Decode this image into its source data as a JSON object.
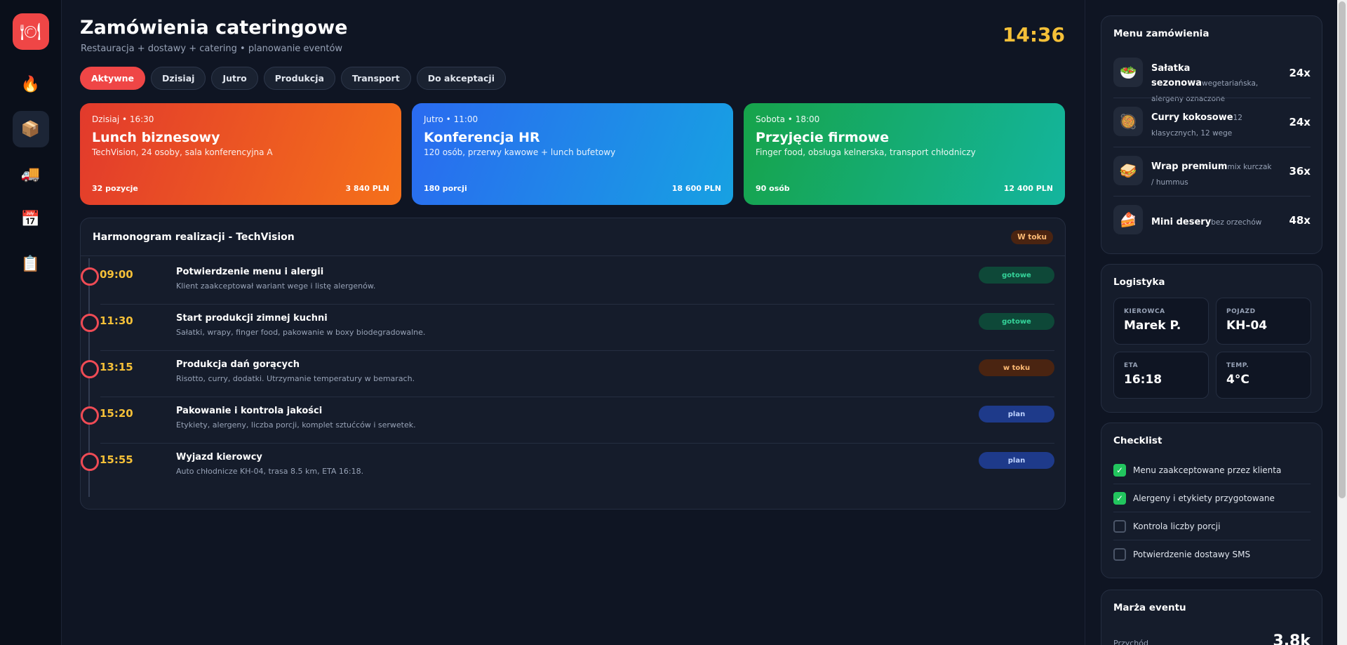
{
  "app": {
    "title": "Zamówienia cateringowe",
    "subtitle": "Restauracja + dostawy + catering • planowanie eventów",
    "clock": "14:36"
  },
  "sidebar": {
    "logo_icon": "plate-cutlery-icon",
    "items": [
      {
        "icon": "fire-icon",
        "glyph": "🔥"
      },
      {
        "icon": "package-icon",
        "glyph": "📦"
      },
      {
        "icon": "delivery-truck-icon",
        "glyph": "🚚"
      },
      {
        "icon": "calendar-icon",
        "glyph": "📅"
      },
      {
        "icon": "clipboard-icon",
        "glyph": "📋"
      }
    ]
  },
  "tabs": [
    "Aktywne",
    "Dzisiaj",
    "Jutro",
    "Produkcja",
    "Transport",
    "Do akceptacji"
  ],
  "events": [
    {
      "when": "Dzisiaj • 16:30",
      "title": "Lunch biznesowy",
      "desc": "TechVision, 24 osoby, sala konferencyjna A",
      "count": "32 pozycje",
      "price": "3 840 PLN"
    },
    {
      "when": "Jutro • 11:00",
      "title": "Konferencja HR",
      "desc": "120 osób, przerwy kawowe + lunch bufetowy",
      "count": "180 porcji",
      "price": "18 600 PLN"
    },
    {
      "when": "Sobota • 18:00",
      "title": "Przyjęcie firmowe",
      "desc": "Finger food, obsługa kelnerska, transport chłodniczy",
      "count": "90 osób",
      "price": "12 400 PLN"
    }
  ],
  "schedule": {
    "title": "Harmonogram realizacji - TechVision",
    "badge": "W toku",
    "rows": [
      {
        "time": "09:00",
        "name": "Potwierdzenie menu i alergii",
        "desc": "Klient zaakceptował wariant wege i listę alergenów.",
        "status": "gotowe"
      },
      {
        "time": "11:30",
        "name": "Start produkcji zimnej kuchni",
        "desc": "Sałatki, wrapy, finger food, pakowanie w boxy biodegradowalne.",
        "status": "gotowe"
      },
      {
        "time": "13:15",
        "name": "Produkcja dań gorących",
        "desc": "Risotto, curry, dodatki. Utrzymanie temperatury w bemarach.",
        "status": "w toku"
      },
      {
        "time": "15:20",
        "name": "Pakowanie i kontrola jakości",
        "desc": "Etykiety, alergeny, liczba porcji, komplet sztućców i serwetek.",
        "status": "plan"
      },
      {
        "time": "15:55",
        "name": "Wyjazd kierowcy",
        "desc": "Auto chłodnicze KH-04, trasa 8.5 km, ETA 16:18.",
        "status": "plan"
      }
    ]
  },
  "menu": {
    "title": "Menu zamówienia",
    "items": [
      {
        "icon": "salad-bowl-icon",
        "glyph": "🥗",
        "name": "Sałatka sezonowa",
        "note": "wegetariańska, alergeny oznaczone",
        "qty": "24x"
      },
      {
        "icon": "curry-dish-icon",
        "glyph": "🥘",
        "name": "Curry kokosowe",
        "note": "12 klasycznych, 12 wege",
        "qty": "24x"
      },
      {
        "icon": "wrap-sandwich-icon",
        "glyph": "🥪",
        "name": "Wrap premium",
        "note": "mix kurczak / hummus",
        "qty": "36x"
      },
      {
        "icon": "cake-slice-icon",
        "glyph": "🍰",
        "name": "Mini desery",
        "note": "bez orzechów",
        "qty": "48x"
      }
    ]
  },
  "logistics": {
    "title": "Logistyka",
    "cells": [
      {
        "label": "KIEROWCA",
        "value": "Marek P."
      },
      {
        "label": "POJAZD",
        "value": "KH-04"
      },
      {
        "label": "ETA",
        "value": "16:18"
      },
      {
        "label": "TEMP.",
        "value": "4°C"
      }
    ]
  },
  "checklist": {
    "title": "Checklist",
    "items": [
      {
        "label": "Menu zaakceptowane przez klienta",
        "checked": true
      },
      {
        "label": "Alergeny i etykiety przygotowane",
        "checked": true
      },
      {
        "label": "Kontrola liczby porcji",
        "checked": false
      },
      {
        "label": "Potwierdzenie dostawy SMS",
        "checked": false
      }
    ]
  },
  "margin": {
    "title": "Marża eventu",
    "label": "Przychód",
    "value": "3.8k"
  },
  "colors": {
    "accent_red": "#ef4646",
    "clock_yellow": "#f5c038",
    "status_done": "#34d399",
    "status_progress": "#fdba74",
    "status_plan": "#bfd3ff"
  }
}
